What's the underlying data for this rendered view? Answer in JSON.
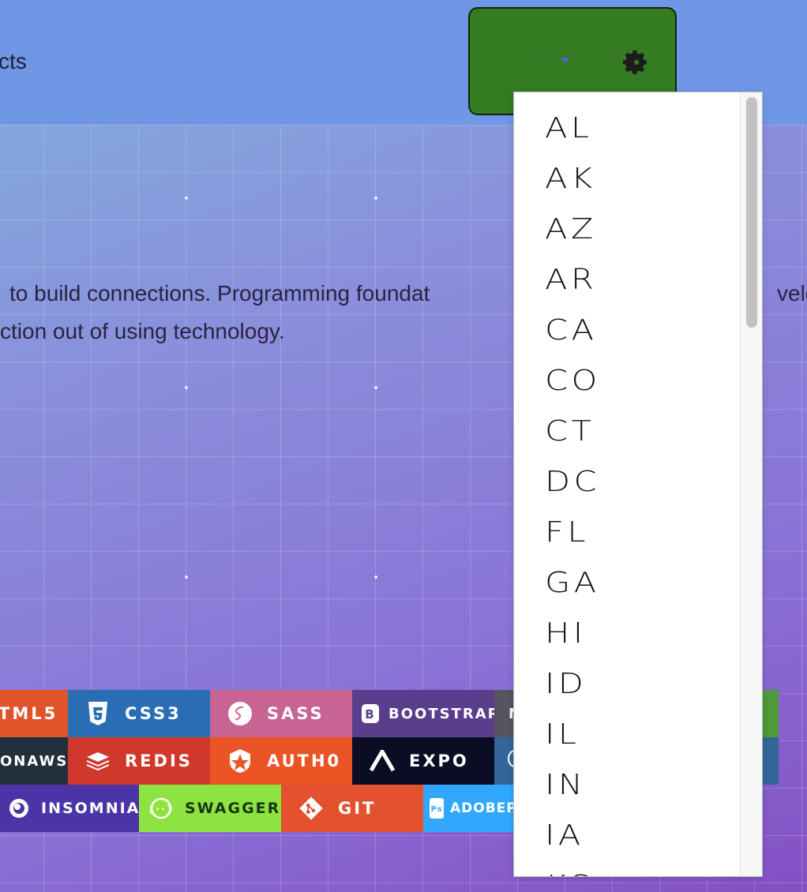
{
  "header": {
    "nav_partial": "cts",
    "select_value": "--",
    "settings_icon": "gear-icon"
  },
  "intro": {
    "line1": "to build connections. Programming foundat",
    "line1_tail": "velo",
    "line2": "ction out of using technology."
  },
  "badges": {
    "row1": [
      {
        "label": "TML5",
        "color": "#e0542b",
        "icon": "html5-icon"
      },
      {
        "label": "CSS3",
        "color": "#2a6db5",
        "icon": "css3-icon"
      },
      {
        "label": "SASS",
        "color": "#c76494",
        "icon": "sass-icon"
      },
      {
        "label": "BOOTSTRAP",
        "color": "#5a3e8c",
        "icon": "bootstrap-icon"
      },
      {
        "label": "M",
        "color": "#555560",
        "icon": ""
      }
    ],
    "row2": [
      {
        "label": "ONAWS",
        "color": "#22303e",
        "icon": ""
      },
      {
        "label": "REDIS",
        "color": "#d0382b",
        "icon": "redis-icon"
      },
      {
        "label": "AUTH0",
        "color": "#eb5424",
        "icon": "auth0-icon"
      },
      {
        "label": "EXPO",
        "color": "#0b0d25",
        "icon": "expo-icon"
      },
      {
        "label": "",
        "color": "#336699",
        "icon": "postgres-icon"
      }
    ],
    "row3": [
      {
        "label": "INSOMNIA",
        "color": "#4b35a6",
        "icon": "insomnia-icon"
      },
      {
        "label": "SWAGGER",
        "color": "#8de33f",
        "icon": "swagger-icon"
      },
      {
        "label": "GIT",
        "color": "#e4512f",
        "icon": "git-icon"
      },
      {
        "label": "ADOBEPHOT",
        "color": "#31a8ff",
        "icon": "photoshop-icon"
      }
    ]
  },
  "dropdown": {
    "options": [
      "AL",
      "AK",
      "AZ",
      "AR",
      "CA",
      "CO",
      "CT",
      "DC",
      "FL",
      "GA",
      "HI",
      "ID",
      "IL",
      "IN",
      "IA",
      "KS"
    ]
  }
}
